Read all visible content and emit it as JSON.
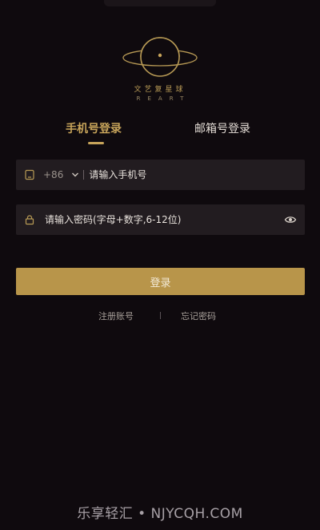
{
  "brand": {
    "name_cn": "文艺复星球",
    "name_en": "REART"
  },
  "tabs": [
    {
      "label": "手机号登录",
      "active": true
    },
    {
      "label": "邮箱号登录",
      "active": false
    }
  ],
  "phone_field": {
    "country_code": "+86",
    "placeholder": "请输入手机号",
    "value": ""
  },
  "password_field": {
    "placeholder": "请输入密码(字母+数字,6-12位)",
    "value": ""
  },
  "login_button": {
    "label": "登录"
  },
  "links": {
    "register": "注册账号",
    "forgot": "忘记密码"
  },
  "watermark": "乐享轻汇 • NJYCQH.COM",
  "colors": {
    "background": "#0f0a0e",
    "accent_gold": "#c7a45a",
    "button": "#b8954a",
    "field": "#221c20"
  },
  "icons": {
    "phone": "phone-icon",
    "chevron": "chevron-down-icon",
    "lock": "lock-icon",
    "eye": "eye-icon",
    "logo": "planet-logo-icon"
  }
}
